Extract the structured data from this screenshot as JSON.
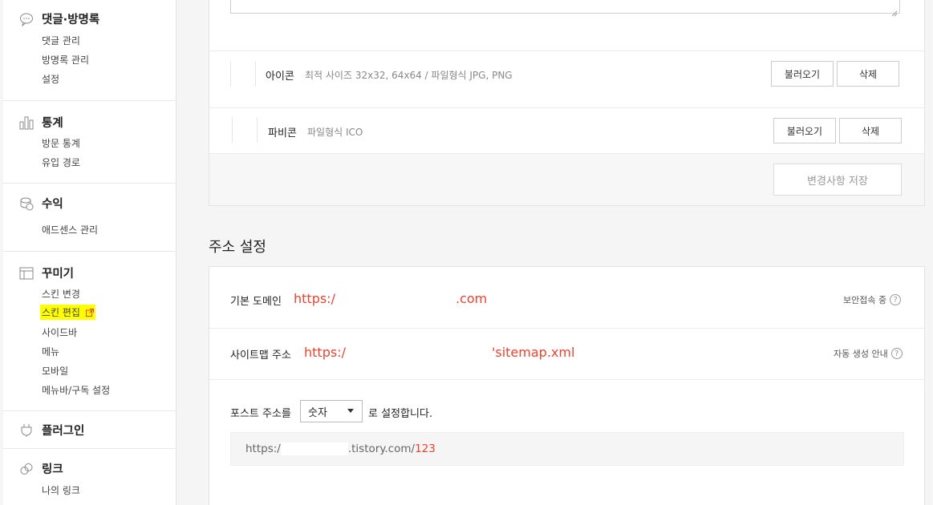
{
  "sidebar": {
    "comments": {
      "title": "댓글·방명록",
      "items": [
        "댓글 관리",
        "방명록 관리",
        "설정"
      ]
    },
    "stats": {
      "title": "통계",
      "items": [
        "방문 통계",
        "유입 경로"
      ]
    },
    "revenue": {
      "title": "수익",
      "items": [
        "애드센스 관리"
      ]
    },
    "decorate": {
      "title": "꾸미기",
      "items": [
        "스킨 변경",
        "스킨 편집",
        "사이드바",
        "메뉴",
        "모바일",
        "메뉴바/구독 설정"
      ]
    },
    "plugin": {
      "title": "플러그인"
    },
    "link": {
      "title": "링크",
      "items": [
        "나의 링크"
      ]
    }
  },
  "icon_row": {
    "label": "아이콘",
    "desc": "최적 사이즈 32x32, 64x64 / 파일형식 JPG, PNG",
    "load_label": "불러오기",
    "delete_label": "삭제"
  },
  "favicon_row": {
    "label": "파비콘",
    "desc": "파일형식 ICO",
    "load_label": "불러오기",
    "delete_label": "삭제"
  },
  "save_label": "변경사항 저장",
  "address": {
    "section_title": "주소 설정",
    "domain_label": "기본 도메인",
    "domain_prefix": "https:/",
    "domain_suffix": ".com",
    "secure_note": "보안접속 중",
    "sitemap_label": "사이트맵 주소",
    "sitemap_prefix": "https:/",
    "sitemap_suffix": "'sitemap.xml",
    "sitemap_note": "자동 생성 안내",
    "post_label": "포스트 주소를",
    "post_select": "숫자",
    "post_suffix": "로 설정합니다.",
    "preview_prefix": "https:/",
    "preview_domain": ".tistory.com/",
    "preview_num": "123"
  },
  "colors": {
    "accent_red": "#e8442f",
    "highlight": "#ffff00"
  }
}
